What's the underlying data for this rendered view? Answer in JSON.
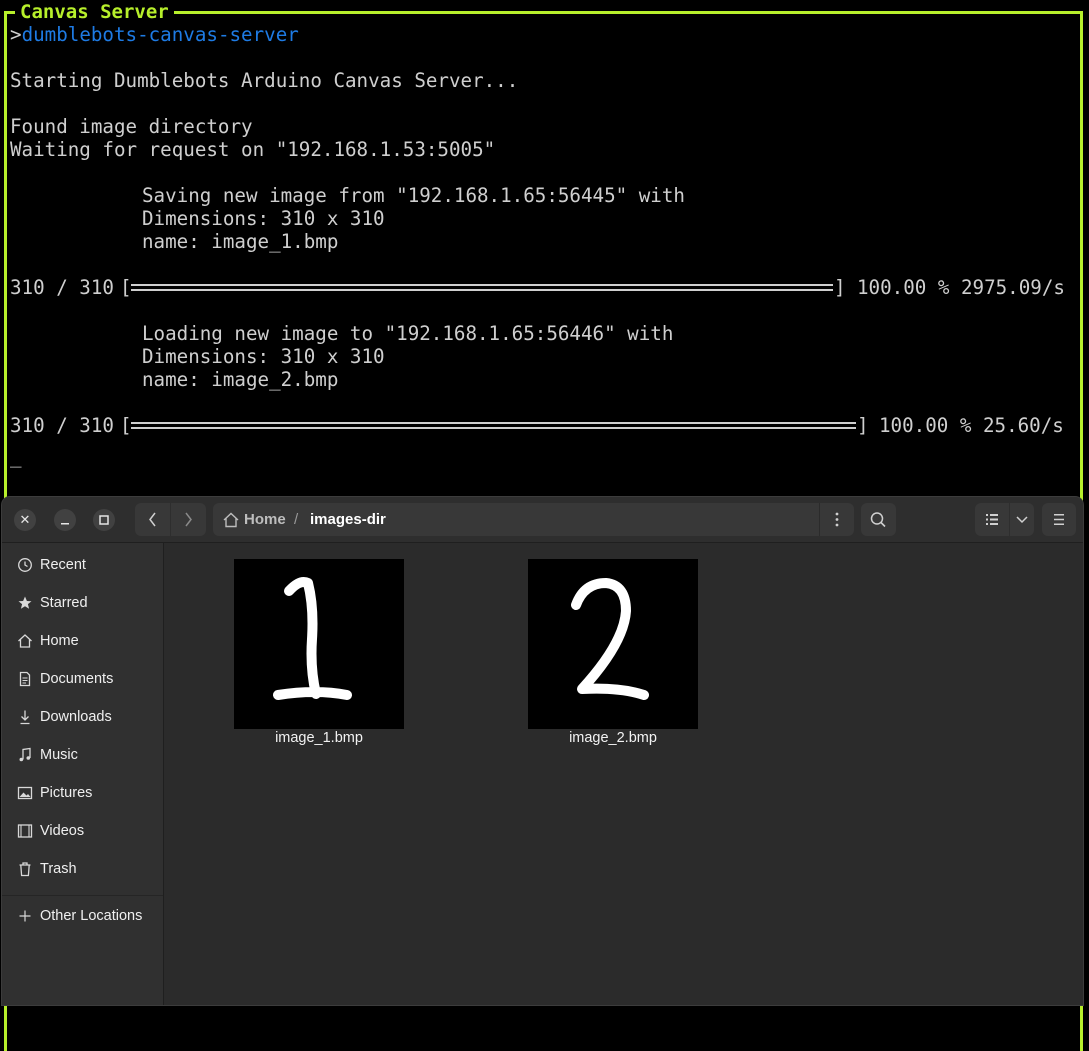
{
  "terminal": {
    "title": "Canvas Server",
    "prompt_symbol": ">",
    "command": "dumblebots-canvas-server",
    "lines": {
      "starting": "Starting Dumblebots Arduino Canvas Server...",
      "found_dir": "Found image directory",
      "waiting": "Waiting for request on \"192.168.1.53:5005\"",
      "save_header": "Saving new image from \"192.168.1.65:56445\" with",
      "save_dims": "Dimensions: 310 x 310",
      "save_name": "name: image_1.bmp",
      "save_progress_count": "310 / 310",
      "save_progress_stats": "100.00 % 2975.09/s",
      "load_header": "Loading new image to \"192.168.1.65:56446\" with",
      "load_dims": "Dimensions: 310 x 310",
      "load_name": "name: image_2.bmp",
      "load_progress_count": "310 / 310",
      "load_progress_stats": "100.00 % 25.60/s",
      "cursor": "_"
    },
    "save_progress_fraction": 1.0,
    "load_progress_fraction": 1.0,
    "colors": {
      "border": "#b7ef2b",
      "command": "#1e7be4",
      "text": "#cfcfcf"
    }
  },
  "file_manager": {
    "window_buttons": {
      "close": "close-icon",
      "minimize": "minimize-icon",
      "maximize": "maximize-icon"
    },
    "path": {
      "home": "Home",
      "separator": "/",
      "current": "images-dir"
    },
    "sidebar": {
      "items": [
        {
          "label": "Recent",
          "icon": "clock-icon"
        },
        {
          "label": "Starred",
          "icon": "star-icon"
        },
        {
          "label": "Home",
          "icon": "home-icon"
        },
        {
          "label": "Documents",
          "icon": "document-icon"
        },
        {
          "label": "Downloads",
          "icon": "download-icon"
        },
        {
          "label": "Music",
          "icon": "music-icon"
        },
        {
          "label": "Pictures",
          "icon": "picture-icon"
        },
        {
          "label": "Videos",
          "icon": "video-icon"
        },
        {
          "label": "Trash",
          "icon": "trash-icon"
        }
      ],
      "other_locations": "Other Locations"
    },
    "files": [
      {
        "name": "image_1.bmp",
        "glyph": "1"
      },
      {
        "name": "image_2.bmp",
        "glyph": "2"
      }
    ]
  }
}
